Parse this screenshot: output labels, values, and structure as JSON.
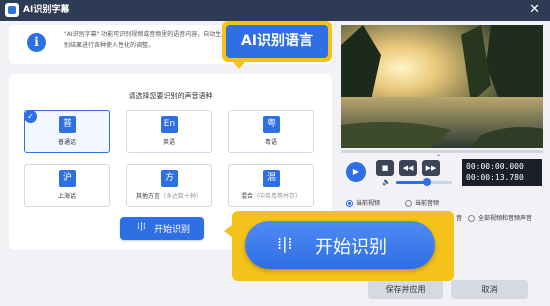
{
  "window": {
    "title": "AI识别字幕",
    "close_glyph": "✕"
  },
  "info": {
    "icon_glyph": "i",
    "text": "\"AI识别字幕\" 功能可识别视频或音频里的语音内容，自动生成字幕，您可对识别结果进行各种使人性化的调整。"
  },
  "callout_tip": {
    "label": "AI识别语言"
  },
  "languages": {
    "prompt": "请选择您要识别的声音语种",
    "items": [
      {
        "glyph": "普",
        "label": "普通话",
        "sub": "",
        "selected": true
      },
      {
        "glyph": "En",
        "label": "英语",
        "sub": "",
        "selected": false
      },
      {
        "glyph": "粤",
        "label": "粤语",
        "sub": "",
        "selected": false
      },
      {
        "glyph": "沪",
        "label": "上海话",
        "sub": "",
        "selected": false
      },
      {
        "glyph": "方",
        "label": "其他方言",
        "sub": "（多达数十种）",
        "selected": false
      },
      {
        "glyph": "混",
        "label": "混合",
        "sub": "（中英粤等并存）",
        "selected": false
      }
    ],
    "check_glyph": "✓"
  },
  "start_button": {
    "label": "开始识别",
    "icon": "waveform-icon",
    "icon_glyph": "⁞|⁞"
  },
  "player": {
    "current_time": "00:00:00.000",
    "total_time": "00:00:13.780",
    "play_glyph": "▶",
    "stop_glyph": "■",
    "prev_glyph": "◀◀",
    "next_glyph": "▶▶",
    "volume_glyph": "🔈",
    "volume_level": 0.55,
    "seek_chevron": "⌄"
  },
  "audio_options": [
    {
      "label": "当前视频",
      "selected": true
    },
    {
      "label": "当前音频",
      "selected": false
    },
    {
      "label": "音",
      "selected": false
    },
    {
      "label": "全部视频和音频声音",
      "selected": false
    }
  ],
  "footer": {
    "save_label": "保存并应用",
    "cancel_label": "取消"
  },
  "colors": {
    "accent": "#2f6fe4",
    "highlight": "#f5c21a",
    "titlebar": "#2e3b55"
  }
}
